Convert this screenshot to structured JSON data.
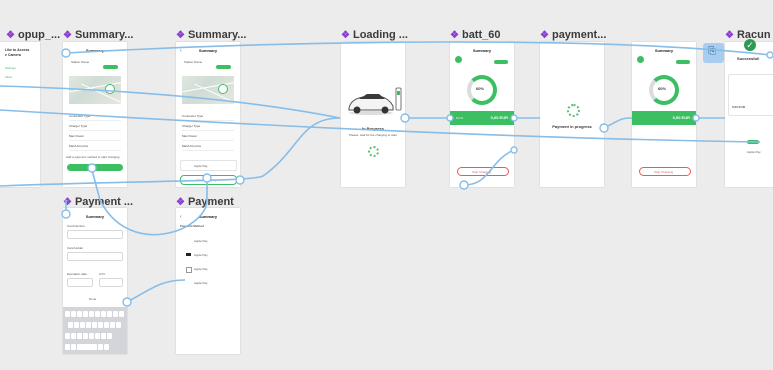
{
  "frames": {
    "popup": {
      "title": "opup_...",
      "line1": "Like to Access",
      "line2": "e Camera",
      "link1": "Settings",
      "link2": "Allow"
    },
    "summary1": {
      "title": "Summary...",
      "header": "Summary",
      "station": "Station Name",
      "rows": [
        "Connector Type",
        "Charger Type",
        "Max Power",
        "Max/Unit price"
      ],
      "note": "Add a payment method to start charging",
      "cta": "Add payment method"
    },
    "summary2": {
      "title": "Summary...",
      "header": "Summary",
      "station": "Station Name",
      "rows": [
        "Connector Type",
        "Charger Type",
        "Max Power",
        "Max/Unit price"
      ],
      "pay_label": "Apple Pay",
      "cta": "Start Charging"
    },
    "loading": {
      "title": "Loading ...",
      "status": "In Progress",
      "sub": "Please, wait for the charging to start"
    },
    "batt60": {
      "title": "batt_60",
      "header": "Summary",
      "percent": "60%",
      "amount": "Km 0",
      "eur": "0,00 EUR",
      "stop": "Stop Charging"
    },
    "payment_progress": {
      "title": "payment...",
      "status": "Payment in progress"
    },
    "batt60b": {
      "header": "Summary",
      "percent": "60%",
      "eur": "0,00 EUR",
      "stop": "Stop Charging"
    },
    "racun": {
      "title": "Racun",
      "status": "Successful!",
      "total": "0,00 EUR",
      "pay": "Apple Pay"
    },
    "payment1": {
      "title": "Payment ...",
      "header": "Summary",
      "labels": [
        "Card Number",
        "Card Holder",
        "Expiration date",
        "CVV"
      ],
      "done": "Done",
      "keys_row3": "space",
      "keys_row3b": "return"
    },
    "payment2": {
      "title": "Payment",
      "header": "Summary",
      "section": "Payment Method",
      "methods": [
        "Apple Pay",
        "Apple Pay",
        "Apple Pay",
        "Apple Pay"
      ]
    }
  },
  "colors": {
    "accent_green": "#3cbf63",
    "wire": "#86bde9",
    "component_diamond": "#8b3fcf",
    "stop_red": "#e25c5c"
  }
}
